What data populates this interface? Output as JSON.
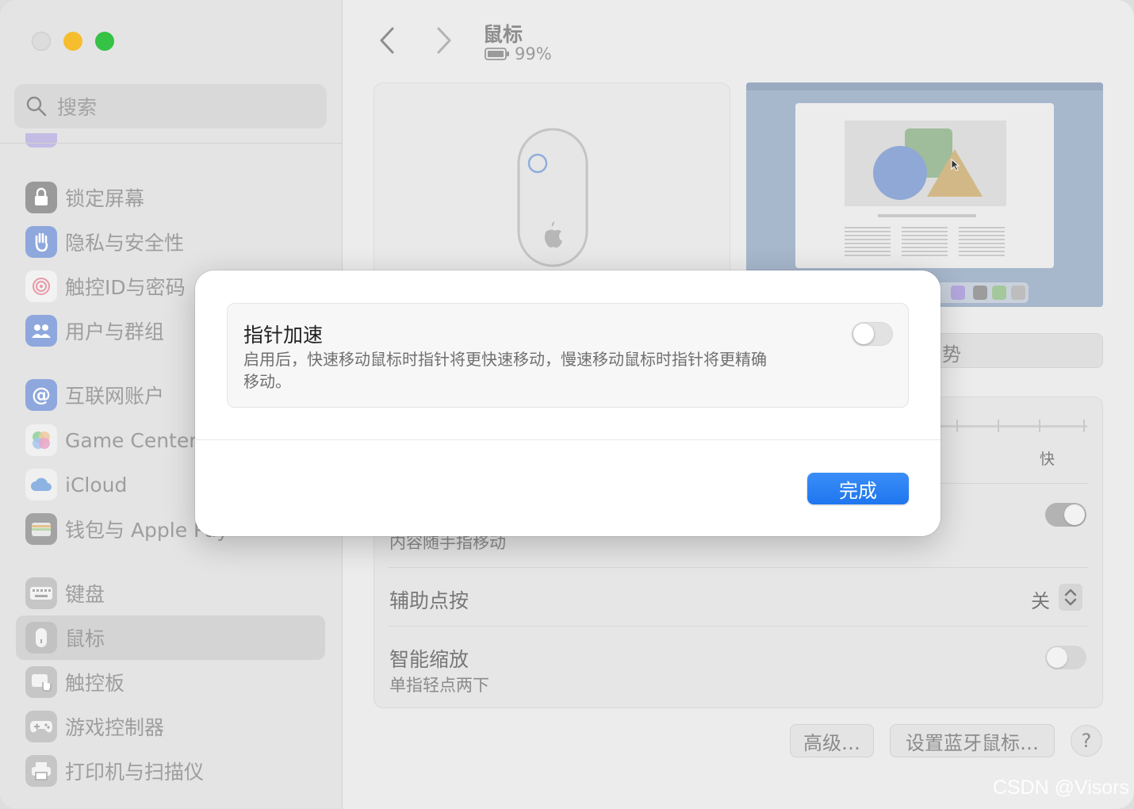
{
  "sidebar": {
    "search_placeholder": "搜索",
    "items": [
      {
        "label": "锁定屏幕",
        "icon": "lock-icon"
      },
      {
        "label": "隐私与安全性",
        "icon": "hand-icon"
      },
      {
        "label": "触控ID与密码",
        "icon": "fingerprint-icon"
      },
      {
        "label": "用户与群组",
        "icon": "users-icon"
      },
      {
        "label": "互联网账户",
        "icon": "at-icon"
      },
      {
        "label": "Game Center",
        "icon": "game-center-icon"
      },
      {
        "label": "iCloud",
        "icon": "cloud-icon"
      },
      {
        "label": "钱包与 Apple Pay",
        "icon": "wallet-icon"
      },
      {
        "label": "键盘",
        "icon": "keyboard-icon"
      },
      {
        "label": "鼠标",
        "icon": "mouse-icon",
        "selected": true
      },
      {
        "label": "触控板",
        "icon": "trackpad-icon"
      },
      {
        "label": "游戏控制器",
        "icon": "gamepad-icon"
      },
      {
        "label": "打印机与扫描仪",
        "icon": "printer-icon"
      }
    ]
  },
  "header": {
    "title": "鼠标",
    "battery": "99%"
  },
  "main": {
    "gesture_button": "势",
    "fast_label": "快",
    "content_follow_sub": "内容随手指移动",
    "assist_click_label": "辅助点按",
    "assist_click_value": "关",
    "smart_zoom_label": "智能缩放",
    "smart_zoom_sub": "单指轻点两下",
    "advanced_button": "高级…",
    "bluetooth_button": "设置蓝牙鼠标…",
    "help_button": "?"
  },
  "dialog": {
    "option_title": "指针加速",
    "option_desc": "启用后，快速移动鼠标时指针将更快速移动，慢速移动鼠标时指针将更精确移动。",
    "toggle_on": false,
    "done_button": "完成"
  },
  "watermark": "CSDN @Visors",
  "colors": {
    "accent": "#1f76ee",
    "traffic_min": "#f6be2f",
    "traffic_max": "#36c245"
  }
}
